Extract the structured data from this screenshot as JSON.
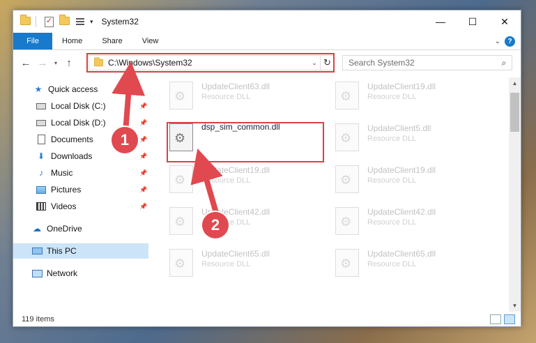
{
  "window": {
    "title": "System32",
    "controls": [
      "—",
      "☐",
      "✕"
    ]
  },
  "ribbon": {
    "file_tab": "File",
    "tabs": [
      "Home",
      "Share",
      "View"
    ]
  },
  "address": {
    "path": "C:\\Windows\\System32"
  },
  "search": {
    "placeholder": "Search System32"
  },
  "nav": {
    "items": [
      {
        "label": "Quick access",
        "icon": "star-icon",
        "pinned": false
      },
      {
        "label": "Local Disk (C:)",
        "icon": "disk-icon",
        "pinned": true
      },
      {
        "label": "Local Disk (D:)",
        "icon": "disk-icon",
        "pinned": true
      },
      {
        "label": "Documents",
        "icon": "document-icon",
        "pinned": true
      },
      {
        "label": "Downloads",
        "icon": "download-icon",
        "pinned": true
      },
      {
        "label": "Music",
        "icon": "music-icon",
        "pinned": true
      },
      {
        "label": "Pictures",
        "icon": "pictures-icon",
        "pinned": true
      },
      {
        "label": "Videos",
        "icon": "videos-icon",
        "pinned": true
      },
      {
        "label": "OneDrive",
        "icon": "onedrive-icon",
        "pinned": false
      },
      {
        "label": "This PC",
        "icon": "this-pc-icon",
        "pinned": false,
        "selected": true
      },
      {
        "label": "Network",
        "icon": "network-icon",
        "pinned": false
      }
    ]
  },
  "files": [
    {
      "name": "UpdateClient63.dll",
      "type": "Resource DLL"
    },
    {
      "name": "UpdateClient19.dll",
      "type": "Resource DLL"
    },
    {
      "name": "dsp_sim_common.dll",
      "type": ""
    },
    {
      "name": "UpdateClient5.dll",
      "type": "Resource DLL"
    },
    {
      "name": "UpdateClient19.dll",
      "type": "Resource DLL"
    },
    {
      "name": "UpdateClient19.dll",
      "type": "Resource DLL"
    },
    {
      "name": "UpdateClient42.dll",
      "type": "Resource DLL"
    },
    {
      "name": "UpdateClient42.dll",
      "type": "Resource DLL"
    },
    {
      "name": "UpdateClient65.dll",
      "type": "Resource DLL"
    },
    {
      "name": "UpdateClient65.dll",
      "type": "Resource DLL"
    }
  ],
  "status": {
    "item_count": "119 items"
  },
  "callouts": [
    "1",
    "2"
  ],
  "colors": {
    "accent": "#1979ca",
    "highlight": "#d94046",
    "selected": "#cce4f7"
  }
}
